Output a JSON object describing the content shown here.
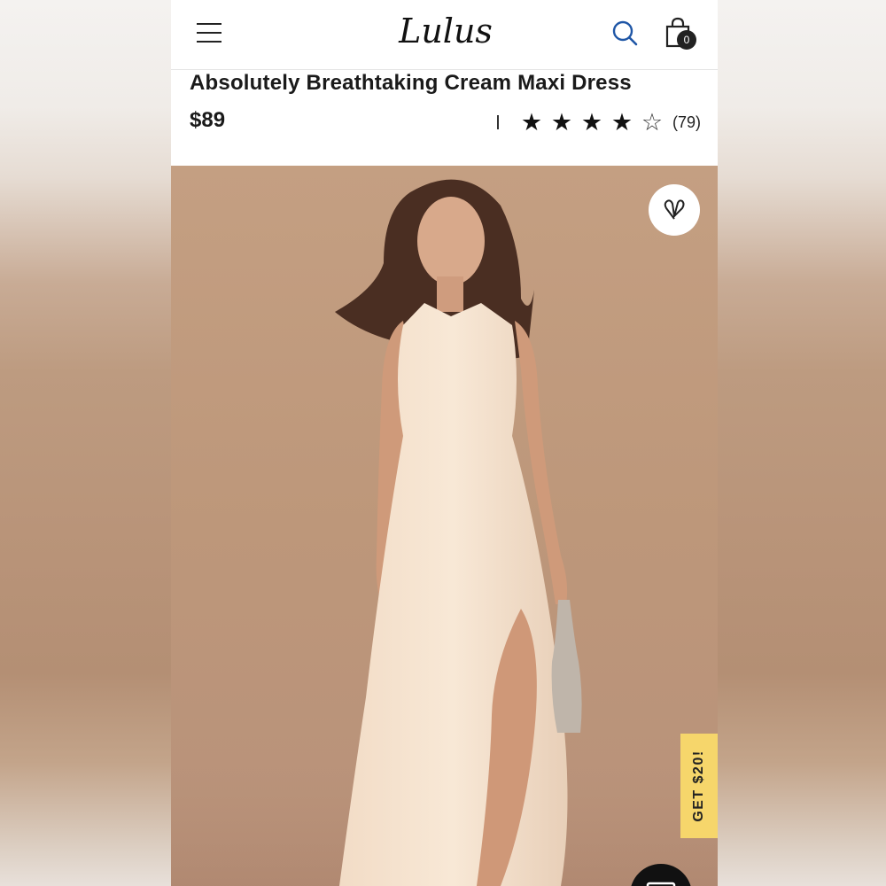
{
  "header": {
    "logo": "Lulus",
    "cart_count": "0"
  },
  "product": {
    "title": "Absolutely Breathtaking Cream Maxi Dress",
    "price": "$89",
    "rating_value": 4,
    "rating_max": 5,
    "review_count": "(79)"
  },
  "promo": {
    "label": "GET $20!"
  },
  "icons": {
    "menu": "hamburger-menu-icon",
    "search": "search-icon",
    "bag": "shopping-bag-icon",
    "favorite": "heart-icon",
    "chat": "chat-icon"
  },
  "colors": {
    "search_icon": "#1f56a6",
    "promo_tab": "#f6d66b",
    "hero_background": "#c49f82"
  }
}
